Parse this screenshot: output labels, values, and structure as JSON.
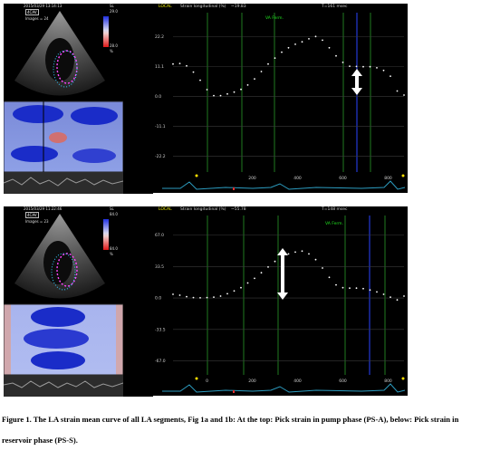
{
  "figure": {
    "caption": "Figure 1. The LA strain mean curve of all LA segments, Fig 1a and 1b: At the top: Pick strain in pump phase (PS-A), below: Pick strain in reservoir phase (PS-S)."
  },
  "panels": [
    {
      "echo": {
        "timestamp": "2015/03/29 13:14:13",
        "mode": "4CAV",
        "images": "Images = 24",
        "scale_unit": "SL",
        "scale_top": "29.0",
        "scale_bottom": "28.0",
        "scale_pct": "%"
      },
      "chart_data": {
        "type": "line",
        "header": {
          "local": "LOCAL",
          "measure": "Strain longitudinal (%)",
          "value": "~19.83",
          "time": "T=161 msec"
        },
        "marker_label": "VA Ferm.",
        "y_ticks": [
          "22.2",
          "11.1",
          "0.0",
          "-11.1",
          "-22.2"
        ],
        "x_ticks": [
          "200",
          "400",
          "600",
          "800"
        ],
        "ylim": [
          -28,
          31
        ],
        "xlim": [
          -150,
          870
        ],
        "x": [
          -150,
          -120,
          -90,
          -60,
          -30,
          0,
          30,
          60,
          90,
          120,
          150,
          180,
          210,
          240,
          270,
          300,
          330,
          360,
          390,
          420,
          450,
          480,
          510,
          540,
          570,
          600,
          630,
          660,
          690,
          720,
          750,
          780,
          810,
          840,
          870
        ],
        "series": [
          {
            "values": [
              12,
              12.2,
              11.3,
              9,
              6,
              2.5,
              0.3,
              0.3,
              0.9,
              1.6,
              2.6,
              4.2,
              6.5,
              9.2,
              12,
              14.2,
              16.4,
              18,
              19.3,
              20.2,
              21.3,
              22.2,
              20.8,
              18,
              15,
              12.6,
              11.2,
              11.1,
              11,
              11,
              10.6,
              9.6,
              7.5,
              2,
              0.5
            ]
          }
        ]
      }
    },
    {
      "echo": {
        "timestamp": "2015/03/29 11:22:46",
        "mode": "4CAV",
        "images": "Images = 23",
        "scale_unit": "SL",
        "scale_top": "84.0",
        "scale_bottom": "84.0",
        "scale_pct": "%"
      },
      "chart_data": {
        "type": "line",
        "header": {
          "local": "LOCAL",
          "measure": "Strain longitudinal (%)",
          "value": "~55.78",
          "time": "T=148 msec"
        },
        "marker_label": "VA Ferm.",
        "y_ticks": [
          "67.0",
          "33.5",
          "0.0",
          "-33.5",
          "-67.0"
        ],
        "x_ticks": [
          "0",
          "200",
          "400",
          "600",
          "800"
        ],
        "ylim": [
          -82,
          88
        ],
        "xlim": [
          -150,
          870
        ],
        "x": [
          -150,
          -120,
          -90,
          -60,
          -30,
          0,
          30,
          60,
          90,
          120,
          150,
          180,
          210,
          240,
          270,
          300,
          330,
          360,
          390,
          420,
          450,
          480,
          510,
          540,
          570,
          600,
          630,
          660,
          690,
          720,
          750,
          780,
          810,
          840,
          870
        ],
        "series": [
          {
            "values": [
              4,
              3,
              1.5,
              0.5,
              0.2,
              0.5,
              1,
              2,
              4.5,
              7.5,
              11,
              16,
              21,
              27,
              33,
              39,
              43.5,
              47,
              49,
              50,
              47,
              41,
              32,
              22,
              14,
              11,
              10.5,
              10.5,
              10,
              8.5,
              6.5,
              4,
              1,
              -2,
              2
            ]
          }
        ]
      }
    }
  ]
}
